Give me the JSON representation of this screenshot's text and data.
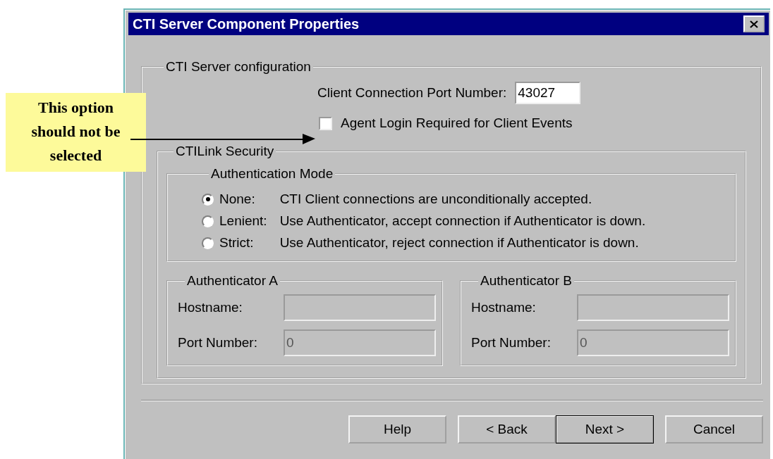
{
  "window": {
    "title": "CTI Server Component Properties"
  },
  "callout": {
    "text": "This option should not be selected"
  },
  "server_configuration": {
    "title": "CTI Server configuration",
    "port_label": "Client Connection Port Number:",
    "port_value": "43027",
    "agent_login": {
      "label": "Agent Login Required for Client Events",
      "checked": false
    },
    "ctilink_security": {
      "title": "CTILink Security",
      "authentication_mode": {
        "title": "Authentication Mode",
        "options": [
          {
            "name": "None:",
            "description": "CTI Client connections are unconditionally accepted.",
            "selected": true
          },
          {
            "name": "Lenient:",
            "description": "Use Authenticator, accept connection if Authenticator is down.",
            "selected": false
          },
          {
            "name": "Strict:",
            "description": "Use Authenticator, reject connection if Authenticator is down.",
            "selected": false
          }
        ]
      },
      "authenticators": [
        {
          "title": "Authenticator A",
          "hostname_label": "Hostname:",
          "port_label": "Port Number:",
          "port_value": "0",
          "disabled": true
        },
        {
          "title": "Authenticator B",
          "hostname_label": "Hostname:",
          "port_label": "Port Number:",
          "port_value": "0",
          "disabled": true
        }
      ]
    }
  },
  "buttons": [
    {
      "label": "Help",
      "default": false
    },
    {
      "label": "< Back",
      "default": false
    },
    {
      "label": "Next >",
      "default": true
    },
    {
      "label": "Cancel",
      "default": false
    }
  ]
}
